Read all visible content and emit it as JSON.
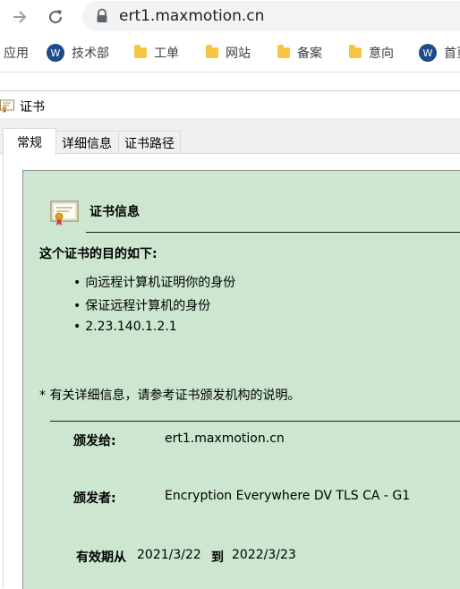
{
  "browser": {
    "url": "ert1.maxmotion.cn",
    "icons": {
      "forward": "forward-arrow-icon",
      "reload": "reload-icon",
      "lock": "lock-icon"
    }
  },
  "bookmarks": [
    {
      "label": "应用",
      "icon": "none"
    },
    {
      "label": "技术部",
      "icon": "site-icon"
    },
    {
      "label": "工单",
      "icon": "folder-icon"
    },
    {
      "label": "网站",
      "icon": "folder-icon"
    },
    {
      "label": "备案",
      "icon": "folder-icon"
    },
    {
      "label": "意向",
      "icon": "folder-icon"
    },
    {
      "label": "首页",
      "icon": "site-icon"
    }
  ],
  "dialog": {
    "title": "证书",
    "tabs": [
      {
        "label": "常规",
        "active": true
      },
      {
        "label": "详细信息",
        "active": false
      },
      {
        "label": "证书路径",
        "active": false
      }
    ],
    "info": {
      "section_title": "证书信息",
      "purpose_heading": "这个证书的目的如下:",
      "purposes": [
        "向远程计算机证明你的身份",
        "保证远程计算机的身份",
        "2.23.140.1.2.1"
      ],
      "note": "* 有关详细信息，请参考证书颁发机构的说明。",
      "issued_to_label": "颁发给:",
      "issued_to_value": "ert1.maxmotion.cn",
      "issued_by_label": "颁发者:",
      "issued_by_value": "Encryption Everywhere DV TLS CA - G1",
      "valid_from_label": "有效期从",
      "valid_from_value": "2021/3/22",
      "valid_to_label": "到",
      "valid_to_value": "2022/3/23"
    },
    "colors": {
      "info_box_bg": "#cce6cf"
    }
  }
}
